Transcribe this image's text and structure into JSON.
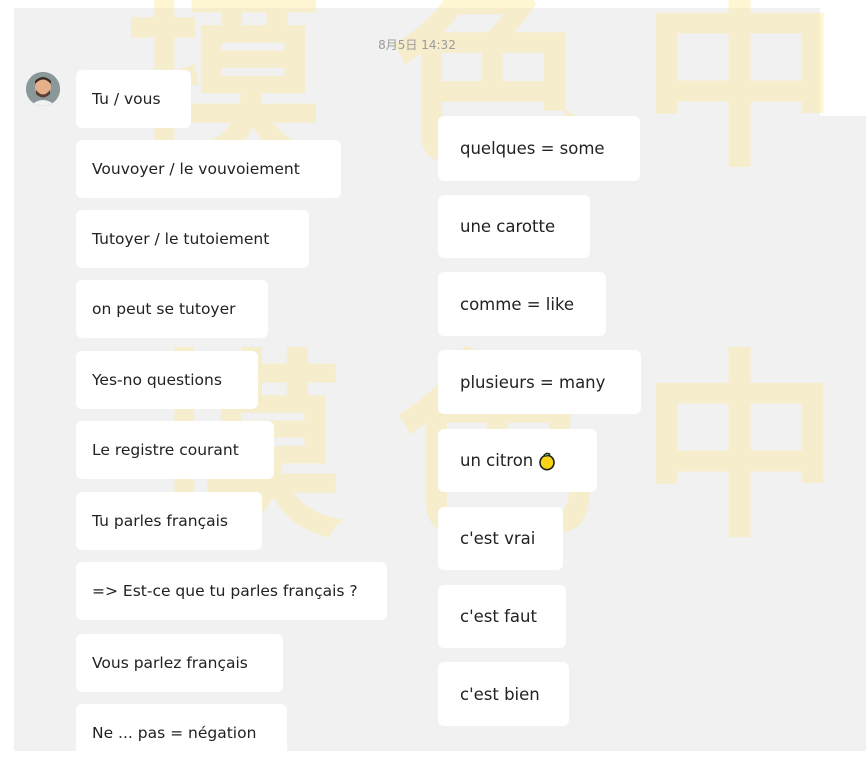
{
  "timestamp": "8月5日 14:32",
  "watermark": {
    "glyphs": [
      "摸",
      "色",
      "中"
    ],
    "color": "#fde9a0"
  },
  "sender": {
    "avatar_icon": "user-avatar"
  },
  "messages_left": [
    "Tu / vous",
    "Vouvoyer / le vouvoiement",
    "Tutoyer / le tutoiement",
    "on peut se tutoyer",
    "Yes-no questions",
    "Le registre courant",
    "Tu parles français",
    "=> Est-ce que tu parles français ?",
    "Vous parlez français",
    "Ne ... pas = négation"
  ],
  "messages_right": [
    "quelques = some",
    "une carotte",
    "comme = like",
    "plusieurs = many",
    "un citron",
    "c'est vrai",
    "c'est faut",
    "c'est bien"
  ],
  "emoji": {
    "name": "lemon-icon",
    "color": "#f7d417"
  }
}
